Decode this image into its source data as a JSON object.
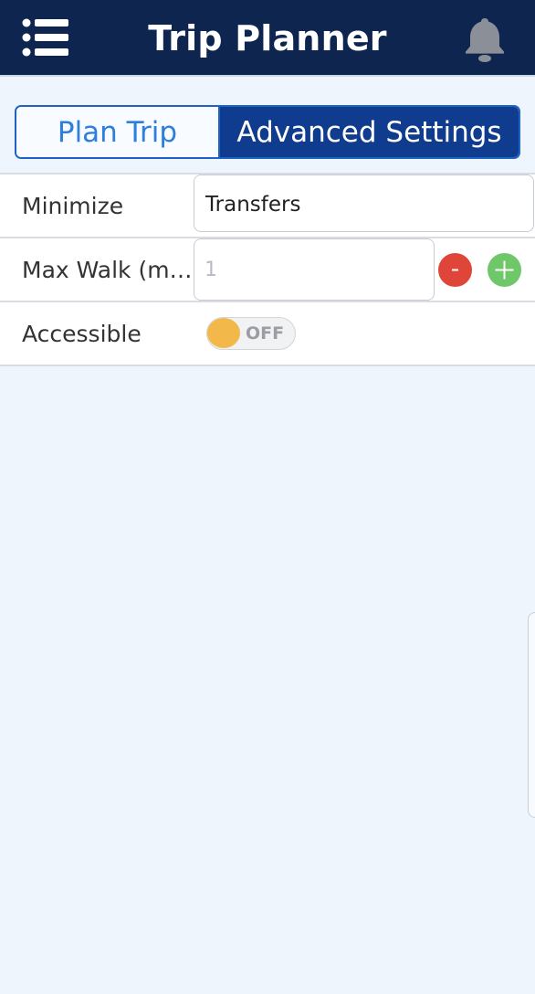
{
  "header": {
    "title": "Trip Planner",
    "menu_icon": "list-menu-icon",
    "bell_icon": "bell-icon"
  },
  "tabs": [
    {
      "label": "Plan Trip",
      "active": false
    },
    {
      "label": "Advanced Settings",
      "active": true
    }
  ],
  "settings": {
    "minimize": {
      "label": "Minimize",
      "value": "Transfers"
    },
    "max_walk": {
      "label": "Max Walk (m…",
      "value": "",
      "placeholder": "1"
    },
    "accessible": {
      "label": "Accessible",
      "state": "OFF"
    }
  },
  "colors": {
    "header_bg": "#0e2550",
    "accent": "#0f3c8e",
    "tab_text": "#2d7fdc",
    "minus": "#e0453a",
    "plus": "#6fc76a",
    "toggle_knob": "#f2b84a",
    "background": "#eef5fd"
  }
}
